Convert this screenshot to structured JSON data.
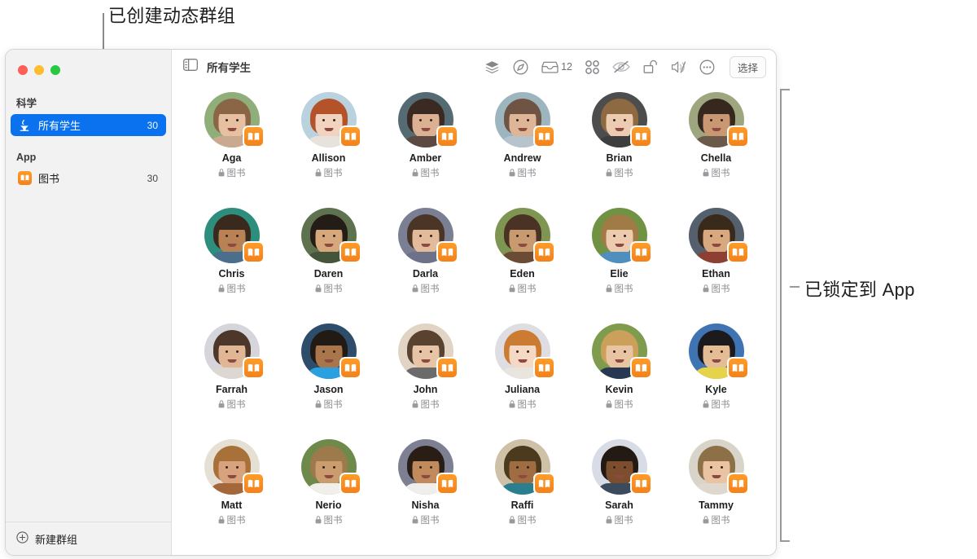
{
  "annotations": [
    {
      "id": "created-dynamic-group",
      "text": "已创建动态群组"
    },
    {
      "id": "locked-to-app",
      "text": "已锁定到 App"
    }
  ],
  "window": {
    "traffic_lights": [
      {
        "name": "close",
        "color": "#ff5f57"
      },
      {
        "name": "minimize",
        "color": "#febc2e"
      },
      {
        "name": "maximize",
        "color": "#28c840"
      }
    ]
  },
  "sidebar": {
    "sections": [
      {
        "header": "科学",
        "items": [
          {
            "label": "所有学生",
            "count": "30",
            "icon": "burner-icon",
            "selected": true
          }
        ]
      },
      {
        "header": "App",
        "items": [
          {
            "label": "图书",
            "count": "30",
            "icon": "books-icon",
            "selected": false
          }
        ]
      }
    ],
    "footer": {
      "label": "新建群组",
      "icon": "plus-circle-icon"
    }
  },
  "toolbar": {
    "sidebar_toggle_icon": "sidebar-toggle-icon",
    "title": "所有学生",
    "actions": [
      {
        "name": "layers-icon",
        "label": ""
      },
      {
        "name": "navigate-icon",
        "label": ""
      },
      {
        "name": "inbox-icon",
        "label": "12"
      },
      {
        "name": "grid-icon",
        "label": ""
      },
      {
        "name": "hide-screen-icon",
        "label": ""
      },
      {
        "name": "unlock-icon",
        "label": ""
      },
      {
        "name": "mute-icon",
        "label": ""
      },
      {
        "name": "more-icon",
        "label": ""
      }
    ],
    "select_button": "选择"
  },
  "students": {
    "app_label": "图书",
    "list": [
      {
        "name": "Aga",
        "bg": "#8fae7a",
        "hair": "#8a6647",
        "skin": "#e7c0a2",
        "shirt": "#c9a98f"
      },
      {
        "name": "Allison",
        "bg": "#b9d2de",
        "hair": "#b4532a",
        "skin": "#f2d3c0",
        "shirt": "#e7e2dc"
      },
      {
        "name": "Amber",
        "bg": "#556b73",
        "hair": "#3b2a22",
        "skin": "#dcb193",
        "shirt": "#5c4a42"
      },
      {
        "name": "Andrew",
        "bg": "#9db5bf",
        "hair": "#6f5443",
        "skin": "#dfb597",
        "shirt": "#b7c4cc"
      },
      {
        "name": "Brian",
        "bg": "#4d4d4d",
        "hair": "#8d6a41",
        "skin": "#eccbb0",
        "shirt": "#3e3e3e"
      },
      {
        "name": "Chella",
        "bg": "#9ea67f",
        "hair": "#36271f",
        "skin": "#c99872",
        "shirt": "#6b5a4a"
      },
      {
        "name": "Chris",
        "bg": "#2d8e7e",
        "hair": "#3a2a1e",
        "skin": "#b98255",
        "shirt": "#4b6e8c"
      },
      {
        "name": "Daren",
        "bg": "#5f7250",
        "hair": "#241c17",
        "skin": "#d7a87c",
        "shirt": "#44553c"
      },
      {
        "name": "Darla",
        "bg": "#7b7f94",
        "hair": "#4a3527",
        "skin": "#e2bb9a",
        "shirt": "#6d7288"
      },
      {
        "name": "Eden",
        "bg": "#7f9653",
        "hair": "#4a3324",
        "skin": "#c89a70",
        "shirt": "#6b4a36"
      },
      {
        "name": "Elie",
        "bg": "#6f9342",
        "hair": "#a07b45",
        "skin": "#eccbaf",
        "shirt": "#4e8fc0"
      },
      {
        "name": "Ethan",
        "bg": "#54606d",
        "hair": "#3a2a1c",
        "skin": "#d8a87f",
        "shirt": "#8e3f33"
      },
      {
        "name": "Farrah",
        "bg": "#d5d5db",
        "hair": "#4c372a",
        "skin": "#e0b694",
        "shirt": "#dcd7d0"
      },
      {
        "name": "Jason",
        "bg": "#2e4d6b",
        "hair": "#221a14",
        "skin": "#a9764c",
        "shirt": "#2aa0e0"
      },
      {
        "name": "John",
        "bg": "#e1d4c4",
        "hair": "#5a4230",
        "skin": "#e8c4a6",
        "shirt": "#6b6b6b"
      },
      {
        "name": "Juliana",
        "bg": "#dedde2",
        "hair": "#cc7b33",
        "skin": "#f6d9c4",
        "shirt": "#e8e4de"
      },
      {
        "name": "Kevin",
        "bg": "#7e9b4e",
        "hair": "#caa05a",
        "skin": "#e9c4a2",
        "shirt": "#283852"
      },
      {
        "name": "Kyle",
        "bg": "#3f74b2",
        "hair": "#1c1a1c",
        "skin": "#e4bc95",
        "shirt": "#e7d34a"
      },
      {
        "name": "Matt",
        "bg": "#e6e0d4",
        "hair": "#a9713a",
        "skin": "#d8a37c",
        "shirt": "#a4673a"
      },
      {
        "name": "Nerio",
        "bg": "#6d8a4a",
        "hair": "#9c7a4c",
        "skin": "#cb9c6d",
        "shirt": "#f0efe9"
      },
      {
        "name": "Nisha",
        "bg": "#7d7f93",
        "hair": "#2a1d16",
        "skin": "#c18a5c",
        "shirt": "#efeeea"
      },
      {
        "name": "Raffi",
        "bg": "#cfc0a8",
        "hair": "#4c3a1e",
        "skin": "#a06c41",
        "shirt": "#2a7f8e"
      },
      {
        "name": "Sarah",
        "bg": "#d8dce6",
        "hair": "#241a14",
        "skin": "#7d4e2e",
        "shirt": "#3b4a5c"
      },
      {
        "name": "Tammy",
        "bg": "#d9d4ca",
        "hair": "#8d7048",
        "skin": "#e9c3a2",
        "shirt": "#ded8cf"
      }
    ]
  },
  "colors": {
    "accent": "#0a72ee",
    "badge_orange": "#f3811a",
    "sidebar_bg": "#f2f2f2",
    "text_primary": "#1d1d1f",
    "text_secondary": "#8e8e93"
  }
}
